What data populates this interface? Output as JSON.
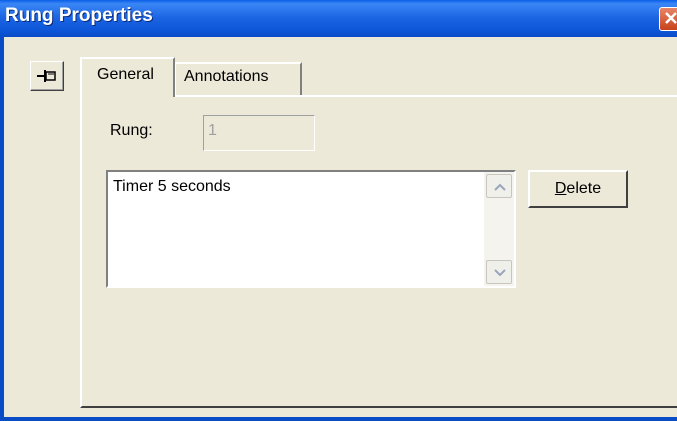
{
  "window": {
    "title": "Rung Properties"
  },
  "tabs": [
    {
      "label": "General",
      "selected": true
    },
    {
      "label": "Annotations",
      "selected": false
    }
  ],
  "general": {
    "rung_label": "Rung:",
    "rung_value": "1",
    "annotation_text": "Timer 5 seconds",
    "delete_button": {
      "mnemonic": "D",
      "rest": "elete"
    }
  },
  "icons": {
    "pin": "pushpin-icon",
    "close": "close-icon",
    "scroll_up": "scroll-up-icon",
    "scroll_down": "scroll-down-icon"
  },
  "colors": {
    "titlebar": "#0a5fe8",
    "close": "#d35a35",
    "face": "#ece9d8"
  }
}
